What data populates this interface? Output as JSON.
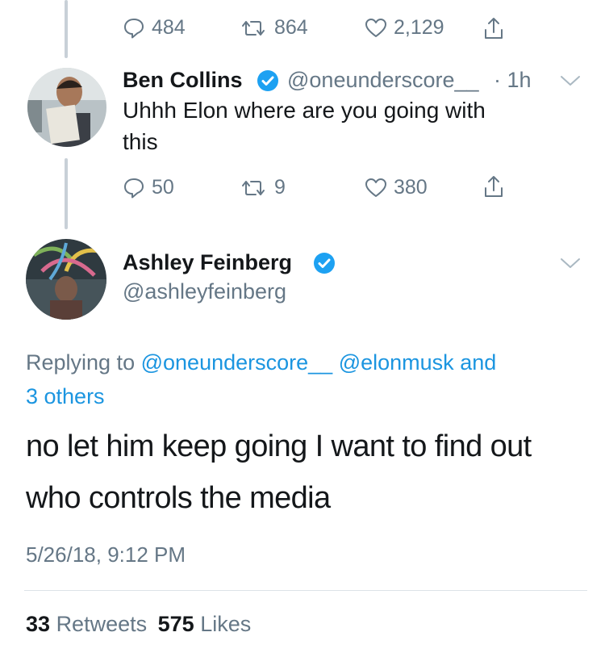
{
  "top_tweet_actions": {
    "replies": "484",
    "retweets": "864",
    "likes": "2,129"
  },
  "reply_tweet": {
    "name": "Ben Collins",
    "handle": "@oneunderscore__",
    "time": "· 1h",
    "text_line1": "Uhhh Elon where are you going with",
    "text_line2": "this",
    "actions": {
      "replies": "50",
      "retweets": "9",
      "likes": "380"
    }
  },
  "main_tweet": {
    "name": "Ashley Feinberg",
    "handle": "@ashleyfeinberg",
    "replying_prefix": "Replying to",
    "reply_to_1": "@oneunderscore__",
    "reply_to_2": "@elonmusk",
    "reply_and": "and",
    "reply_others": "3 others",
    "text_line1": "no let him keep going I want to find out",
    "text_line2": "who controls the media",
    "timestamp": "5/26/18, 9:12 PM",
    "retweets_count": "33",
    "retweets_label": "Retweets",
    "likes_count": "575",
    "likes_label": "Likes"
  },
  "icons": {
    "reply": "reply-icon",
    "retweet": "retweet-icon",
    "like": "heart-icon",
    "share": "share-icon",
    "verified": "verified-badge-icon",
    "menu": "chevron-down-icon"
  },
  "colors": {
    "link": "#1b95e0",
    "muted": "#657786",
    "verified": "#1da1f2",
    "thread_line": "#c8d0d7"
  }
}
